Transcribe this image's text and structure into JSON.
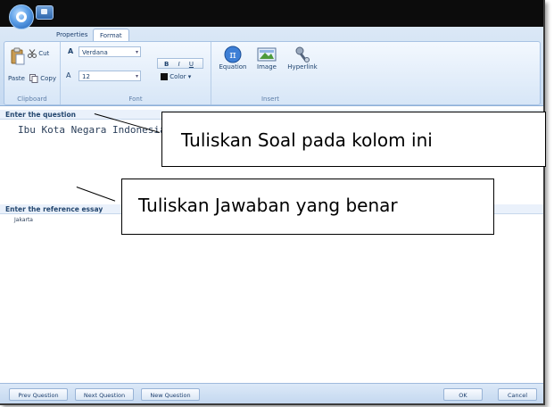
{
  "ribbon": {
    "tabs": [
      "Properties",
      "Format"
    ],
    "clipboard": {
      "paste": "Paste",
      "cut": "Cut",
      "copy": "Copy",
      "label": "Clipboard"
    },
    "font": {
      "name": "Verdana",
      "size": "12",
      "color_label": "Color",
      "label": "Font",
      "bold": "B",
      "italic": "I",
      "underline": "U"
    },
    "insert": {
      "equation": "Equation",
      "image": "Image",
      "hyperlink": "Hyperlink",
      "label": "Insert"
    }
  },
  "question": {
    "header": "Enter the question",
    "text": "Ibu Kota Negara Indonesia..."
  },
  "answer": {
    "header": "Enter the reference essay",
    "text": "Jakarta"
  },
  "buttons": {
    "prev": "Prev Question",
    "next": "Next Question",
    "new": "New Question",
    "ok": "OK",
    "cancel": "Cancel"
  },
  "callouts": {
    "question": "Tuliskan Soal pada kolom ini",
    "answer": "Tuliskan Jawaban yang benar"
  },
  "colors": {
    "accent": "#1e5eb4",
    "ribbon": "#c6daf1",
    "titlebar": "#0c0c0c"
  }
}
